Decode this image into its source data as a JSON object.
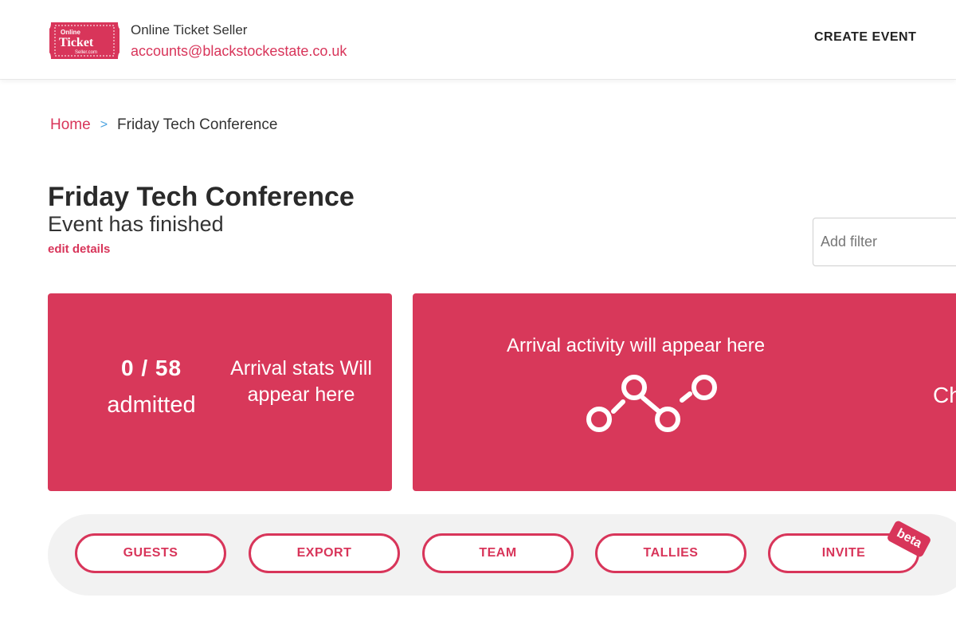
{
  "header": {
    "logo_line1": "Online",
    "logo_line2": "Ticket",
    "logo_line3": "Seller.com",
    "org_name": "Online Ticket Seller",
    "org_email": "accounts@blackstockestate.co.uk",
    "create_event_label": "CREATE EVENT"
  },
  "breadcrumb": {
    "home": "Home",
    "separator": ">",
    "current": "Friday Tech Conference"
  },
  "event": {
    "title": "Friday Tech Conference",
    "status": "Event has finished",
    "edit_label": "edit details"
  },
  "filter": {
    "placeholder": "Add filter"
  },
  "stats_card": {
    "admitted_count": "0 / 58",
    "admitted_label": "admitted",
    "arrival_stats_text": "Arrival stats Will appear here"
  },
  "activity_card": {
    "text": "Arrival activity will appear here",
    "cut_text": "Ch"
  },
  "actions": [
    {
      "label": "GUESTS"
    },
    {
      "label": "EXPORT"
    },
    {
      "label": "TEAM"
    },
    {
      "label": "TALLIES"
    },
    {
      "label": "INVITE"
    }
  ],
  "invite_badge": "beta",
  "colors": {
    "brand": "#d8355a",
    "card": "#d8385a",
    "link_separator": "#4ba3e0"
  },
  "icons": {
    "logo": "ticket-logo",
    "activity": "line-chart-icon"
  }
}
